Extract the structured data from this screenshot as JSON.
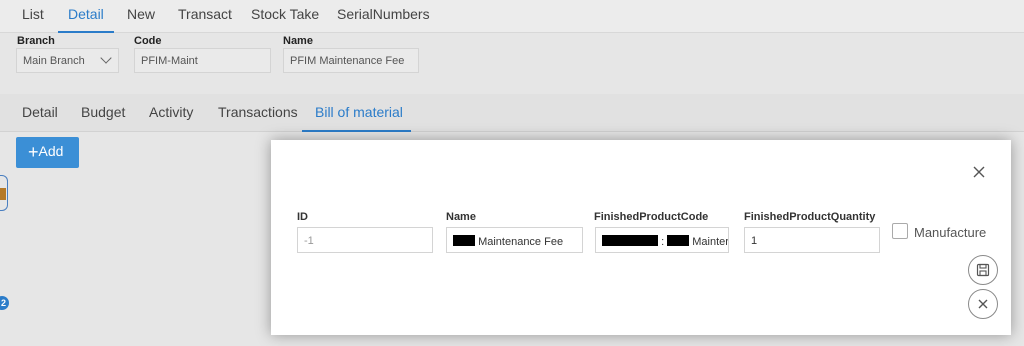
{
  "top_tabs": [
    "List",
    "Detail",
    "New",
    "Transact",
    "Stock Take",
    "SerialNumbers"
  ],
  "top_tabs_active": "Detail",
  "header_fields": {
    "branch": {
      "label": "Branch",
      "value": "Main Branch"
    },
    "code": {
      "label": "Code",
      "value": "PFIM-Maint"
    },
    "name": {
      "label": "Name",
      "value": "PFIM Maintenance Fee"
    }
  },
  "sub_tabs": [
    "Detail",
    "Budget",
    "Activity",
    "Transactions",
    "Bill of material"
  ],
  "sub_tabs_active": "Bill of material",
  "add_button": {
    "icon": "plus-icon",
    "label": "Add"
  },
  "left_edge_badge": "2",
  "modal": {
    "fields": {
      "id": {
        "label": "ID",
        "value": "-1"
      },
      "name": {
        "label": "Name",
        "value": "Maintenance Fee"
      },
      "finished_product_code": {
        "label": "FinishedProductCode",
        "value_suffix": "Mainter",
        "separator": ":"
      },
      "finished_product_quantity": {
        "label": "FinishedProductQuantity",
        "value": "1"
      }
    },
    "manufacture": {
      "label": "Manufacture",
      "checked": false
    },
    "icons": {
      "close": "close-icon",
      "save": "save-icon",
      "cancel": "cancel-icon"
    }
  },
  "colors": {
    "accent": "#2b7cc9",
    "add_button": "#3b8fd6",
    "modal_bg": "#ffffff"
  }
}
